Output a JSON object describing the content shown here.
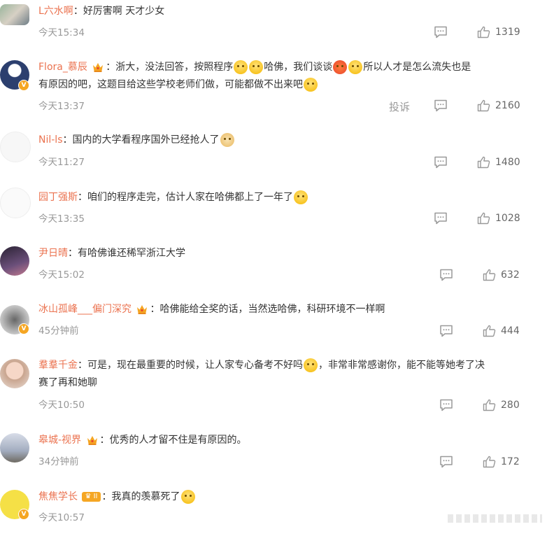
{
  "comments": [
    {
      "user": "L六水啊",
      "text": "好厉害啊 天才少女",
      "time": "今天15:34",
      "likes": "1319"
    },
    {
      "user": "Flora_慕辰",
      "t1": "浙大，没法回答，按照程序",
      "t2": "哈佛，我们谈谈",
      "t3": "所以人才是怎么流失也是",
      "t4": "有原因的吧，这题目给这些学校老师们做，可能都做不出来吧",
      "time": "今天13:37",
      "likes": "2160",
      "report": "投诉"
    },
    {
      "user": "Nil-ls",
      "text": "国内的大学看程序国外已经抢人了",
      "time": "今天11:27",
      "likes": "1480"
    },
    {
      "user": "园丁强斯",
      "text": "咱们的程序走完，估计人家在哈佛都上了一年了",
      "time": "今天13:35",
      "likes": "1028"
    },
    {
      "user": "尹日晴",
      "text": "有哈佛谁还稀罕浙江大学",
      "time": "今天15:02",
      "likes": "632"
    },
    {
      "user": "冰山孤峰___偏门深究",
      "text": "哈佛能给全奖的话，当然选哈佛，科研环境不一样啊",
      "time": "45分钟前",
      "likes": "444"
    },
    {
      "user": "羣羣千金",
      "t1": "可是，现在最重要的时候，让人家专心备考不好吗",
      "t2": "，非常非常感谢你，能不能等她考了决",
      "t3": "赛了再和她聊",
      "time": "今天10:50",
      "likes": "280"
    },
    {
      "user": "皋城-视界",
      "text": "优秀的人才留不住是有原因的。",
      "time": "34分钟前",
      "likes": "172"
    },
    {
      "user": "焦焦学长",
      "text": "我真的羡慕死了",
      "time": "今天10:57",
      "level": "II"
    }
  ],
  "colors": {
    "username": "#eb7350",
    "meta": "#999999",
    "text": "#333333",
    "badge": "#f5a623"
  }
}
